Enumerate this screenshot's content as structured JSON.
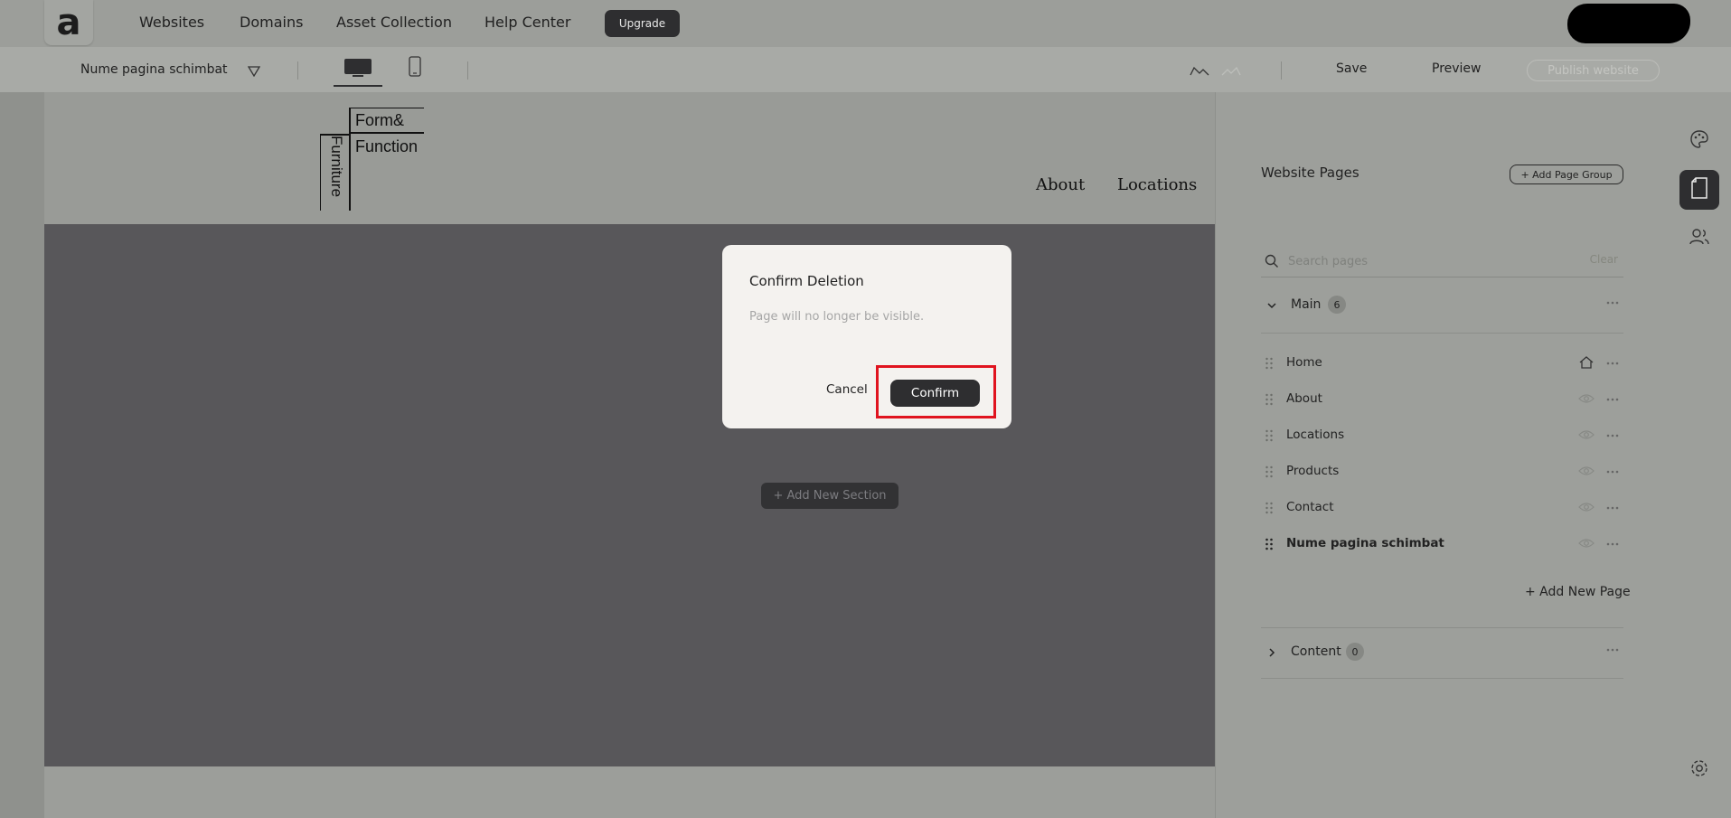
{
  "topnav": {
    "logo_letter": "a",
    "links": [
      "Websites",
      "Domains",
      "Asset Collection",
      "Help Center"
    ],
    "upgrade_label": "Upgrade"
  },
  "toolbar": {
    "page_name": "Nume pagina schimbat",
    "save_label": "Save",
    "preview_label": "Preview",
    "publish_label": "Publish website"
  },
  "site": {
    "logo_line1": "Form&",
    "logo_line2": "Function",
    "logo_vertical": "Furniture",
    "nav": [
      "About",
      "Locations"
    ],
    "add_section_label": "+ Add New Section"
  },
  "panel": {
    "title": "Website Pages",
    "add_group_label": "+ Add Page Group",
    "search_placeholder": "Search pages",
    "clear_label": "Clear",
    "groups": [
      {
        "name": "Main",
        "count": "6"
      },
      {
        "name": "Content",
        "count": "0"
      }
    ],
    "pages": [
      {
        "name": "Home",
        "state": "home-icon"
      },
      {
        "name": "About",
        "state": "eye-icon"
      },
      {
        "name": "Locations",
        "state": "eye-icon"
      },
      {
        "name": "Products",
        "state": "eye-icon"
      },
      {
        "name": "Contact",
        "state": "eye-icon"
      },
      {
        "name": "Nume pagina schimbat",
        "state": "eye-icon"
      }
    ],
    "add_page_label": "+ Add New Page"
  },
  "modal": {
    "title": "Confirm Deletion",
    "message": "Page will no longer be visible.",
    "cancel_label": "Cancel",
    "confirm_label": "Confirm"
  },
  "colors": {
    "accent_dark": "#2e2e30",
    "highlight": "#e0141f"
  }
}
